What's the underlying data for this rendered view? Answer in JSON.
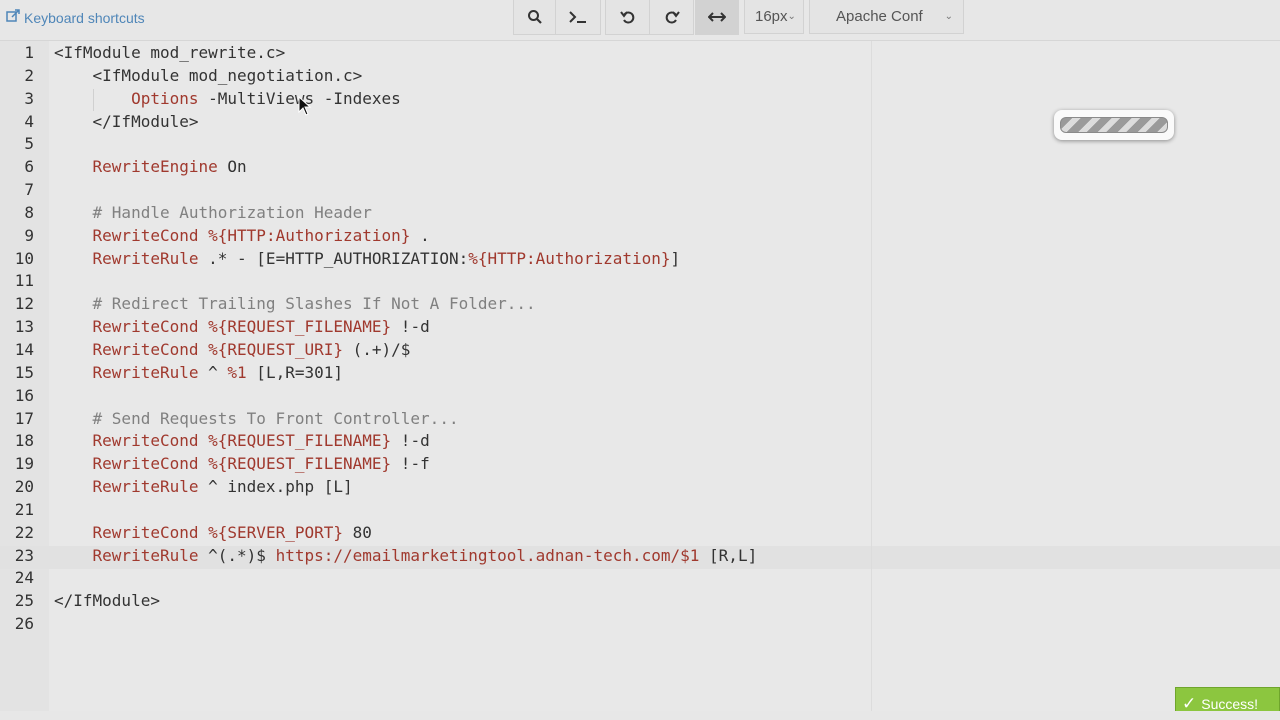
{
  "toolbar": {
    "shortcuts_link": "Keyboard shortcuts",
    "font_size": "16px",
    "mode": "Apache Conf"
  },
  "editor": {
    "lines": [
      {
        "n": "1",
        "segs": [
          [
            "tag",
            "<IfModule "
          ],
          [
            "val",
            "mod_rewrite.c"
          ],
          [
            "tag",
            ">"
          ]
        ]
      },
      {
        "n": "2",
        "segs": [
          [
            "tag",
            "    <IfModule "
          ],
          [
            "val",
            "mod_negotiation.c"
          ],
          [
            "tag",
            ">"
          ]
        ]
      },
      {
        "n": "3",
        "segs": [
          [
            "tag",
            "        "
          ],
          [
            "k",
            "Options"
          ],
          [
            "tag",
            " -MultiViews -Indexes"
          ]
        ]
      },
      {
        "n": "4",
        "segs": [
          [
            "tag",
            "    </IfModule>"
          ]
        ]
      },
      {
        "n": "5",
        "segs": []
      },
      {
        "n": "6",
        "segs": [
          [
            "tag",
            "    "
          ],
          [
            "k",
            "RewriteEngine"
          ],
          [
            "tag",
            " On"
          ]
        ]
      },
      {
        "n": "7",
        "segs": []
      },
      {
        "n": "8",
        "segs": [
          [
            "tag",
            "    "
          ],
          [
            "c",
            "# Handle Authorization Header"
          ]
        ]
      },
      {
        "n": "9",
        "segs": [
          [
            "tag",
            "    "
          ],
          [
            "k",
            "RewriteCond"
          ],
          [
            "tag",
            " "
          ],
          [
            "k",
            "%{HTTP:Authorization}"
          ],
          [
            "tag",
            " ."
          ]
        ]
      },
      {
        "n": "10",
        "segs": [
          [
            "tag",
            "    "
          ],
          [
            "k",
            "RewriteRule"
          ],
          [
            "tag",
            " .* - [E=HTTP_AUTHORIZATION:"
          ],
          [
            "k",
            "%{HTTP:Authorization}"
          ],
          [
            "tag",
            "]"
          ]
        ]
      },
      {
        "n": "11",
        "segs": []
      },
      {
        "n": "12",
        "segs": [
          [
            "tag",
            "    "
          ],
          [
            "c",
            "# Redirect Trailing Slashes If Not A Folder..."
          ]
        ]
      },
      {
        "n": "13",
        "segs": [
          [
            "tag",
            "    "
          ],
          [
            "k",
            "RewriteCond"
          ],
          [
            "tag",
            " "
          ],
          [
            "k",
            "%{REQUEST_FILENAME}"
          ],
          [
            "tag",
            " !-d"
          ]
        ]
      },
      {
        "n": "14",
        "segs": [
          [
            "tag",
            "    "
          ],
          [
            "k",
            "RewriteCond"
          ],
          [
            "tag",
            " "
          ],
          [
            "k",
            "%{REQUEST_URI}"
          ],
          [
            "tag",
            " (.+)/$"
          ]
        ]
      },
      {
        "n": "15",
        "segs": [
          [
            "tag",
            "    "
          ],
          [
            "k",
            "RewriteRule"
          ],
          [
            "tag",
            " ^ "
          ],
          [
            "k",
            "%1"
          ],
          [
            "tag",
            " [L,R=301]"
          ]
        ]
      },
      {
        "n": "16",
        "segs": []
      },
      {
        "n": "17",
        "segs": [
          [
            "tag",
            "    "
          ],
          [
            "c",
            "# Send Requests To Front Controller..."
          ]
        ]
      },
      {
        "n": "18",
        "segs": [
          [
            "tag",
            "    "
          ],
          [
            "k",
            "RewriteCond"
          ],
          [
            "tag",
            " "
          ],
          [
            "k",
            "%{REQUEST_FILENAME}"
          ],
          [
            "tag",
            " !-d"
          ]
        ]
      },
      {
        "n": "19",
        "segs": [
          [
            "tag",
            "    "
          ],
          [
            "k",
            "RewriteCond"
          ],
          [
            "tag",
            " "
          ],
          [
            "k",
            "%{REQUEST_FILENAME}"
          ],
          [
            "tag",
            " !-f"
          ]
        ]
      },
      {
        "n": "20",
        "segs": [
          [
            "tag",
            "    "
          ],
          [
            "k",
            "RewriteRule"
          ],
          [
            "tag",
            " ^ index.php [L]"
          ]
        ]
      },
      {
        "n": "21",
        "segs": []
      },
      {
        "n": "22",
        "segs": [
          [
            "tag",
            "    "
          ],
          [
            "k",
            "RewriteCond"
          ],
          [
            "tag",
            " "
          ],
          [
            "k",
            "%{SERVER_PORT}"
          ],
          [
            "tag",
            " 80"
          ]
        ]
      },
      {
        "n": "23",
        "segs": [
          [
            "tag",
            "    "
          ],
          [
            "k",
            "RewriteRule"
          ],
          [
            "tag",
            " ^(.*)$ "
          ],
          [
            "k",
            "https://emailmarketingtool.adnan-tech.com/$1"
          ],
          [
            "tag",
            " [R,L]"
          ]
        ]
      },
      {
        "n": "24",
        "segs": []
      },
      {
        "n": "25",
        "segs": [
          [
            "tag",
            "</IfModule>"
          ]
        ]
      },
      {
        "n": "26",
        "segs": []
      }
    ]
  },
  "notification": {
    "text": "Success!"
  }
}
